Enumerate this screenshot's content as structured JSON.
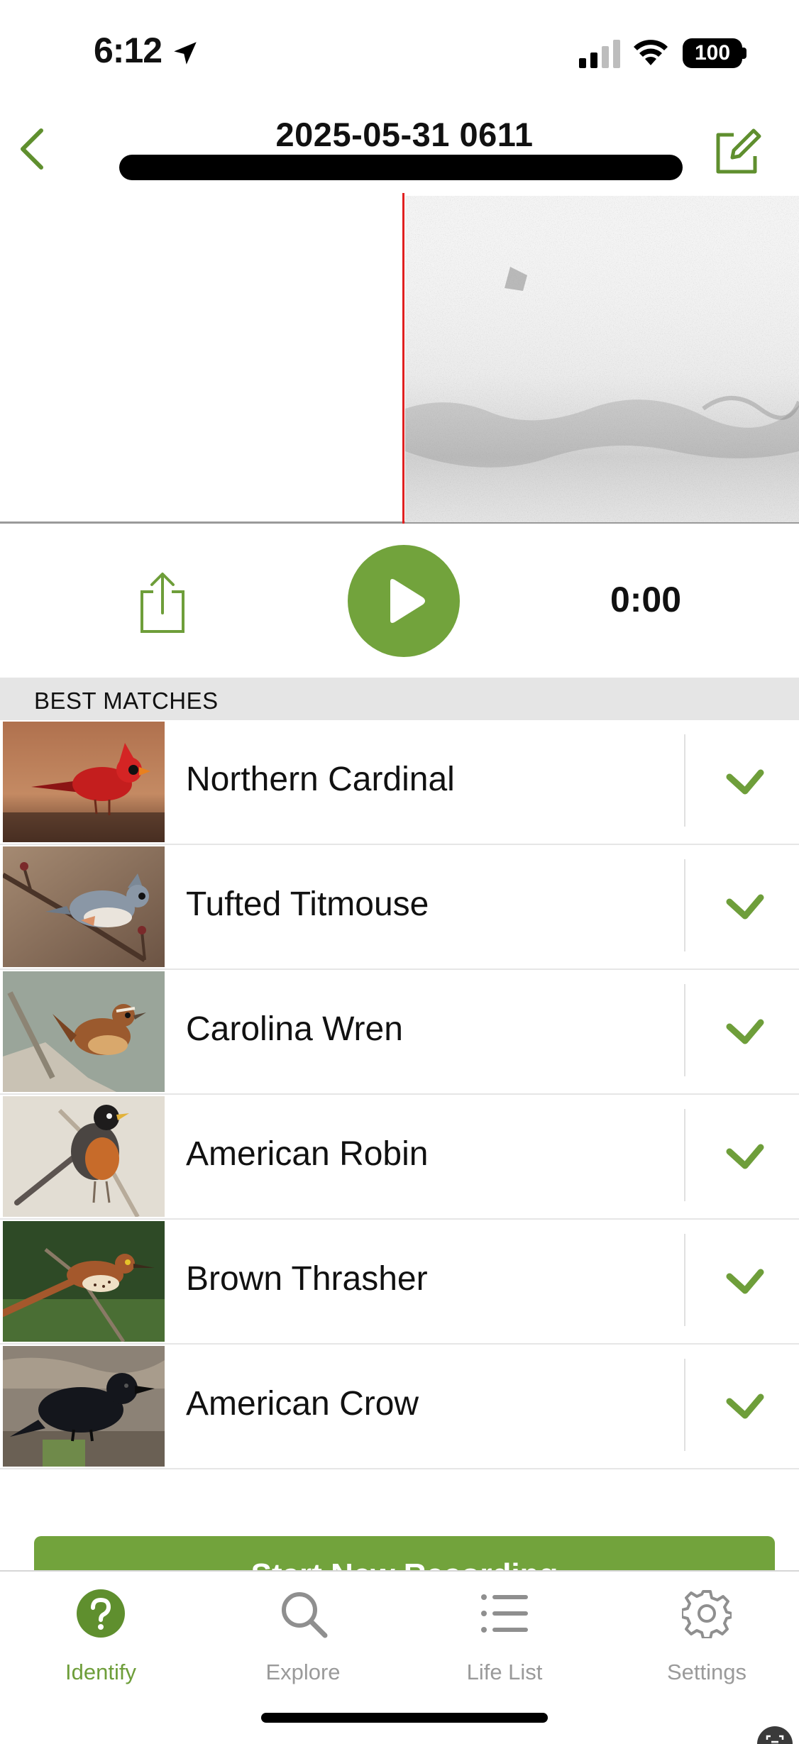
{
  "status_bar": {
    "time": "6:12",
    "battery": "100"
  },
  "header": {
    "title": "2025-05-31 0611"
  },
  "player": {
    "time": "0:00"
  },
  "matches": {
    "heading": "BEST MATCHES",
    "items": [
      {
        "name": "Northern Cardinal"
      },
      {
        "name": "Tufted Titmouse"
      },
      {
        "name": "Carolina Wren"
      },
      {
        "name": "American Robin"
      },
      {
        "name": "Brown Thrasher"
      },
      {
        "name": "American Crow"
      }
    ]
  },
  "start_button": {
    "label": "Start New Recording"
  },
  "tabs": [
    {
      "label": "Identify",
      "icon": "question-circle-icon",
      "active": true
    },
    {
      "label": "Explore",
      "icon": "magnifier-icon",
      "active": false
    },
    {
      "label": "Life List",
      "icon": "list-icon",
      "active": false
    },
    {
      "label": "Settings",
      "icon": "gear-icon",
      "active": false
    }
  ],
  "colors": {
    "accent": "#72a33c",
    "playhead": "#e02020",
    "inactive": "#9a9a9a"
  }
}
